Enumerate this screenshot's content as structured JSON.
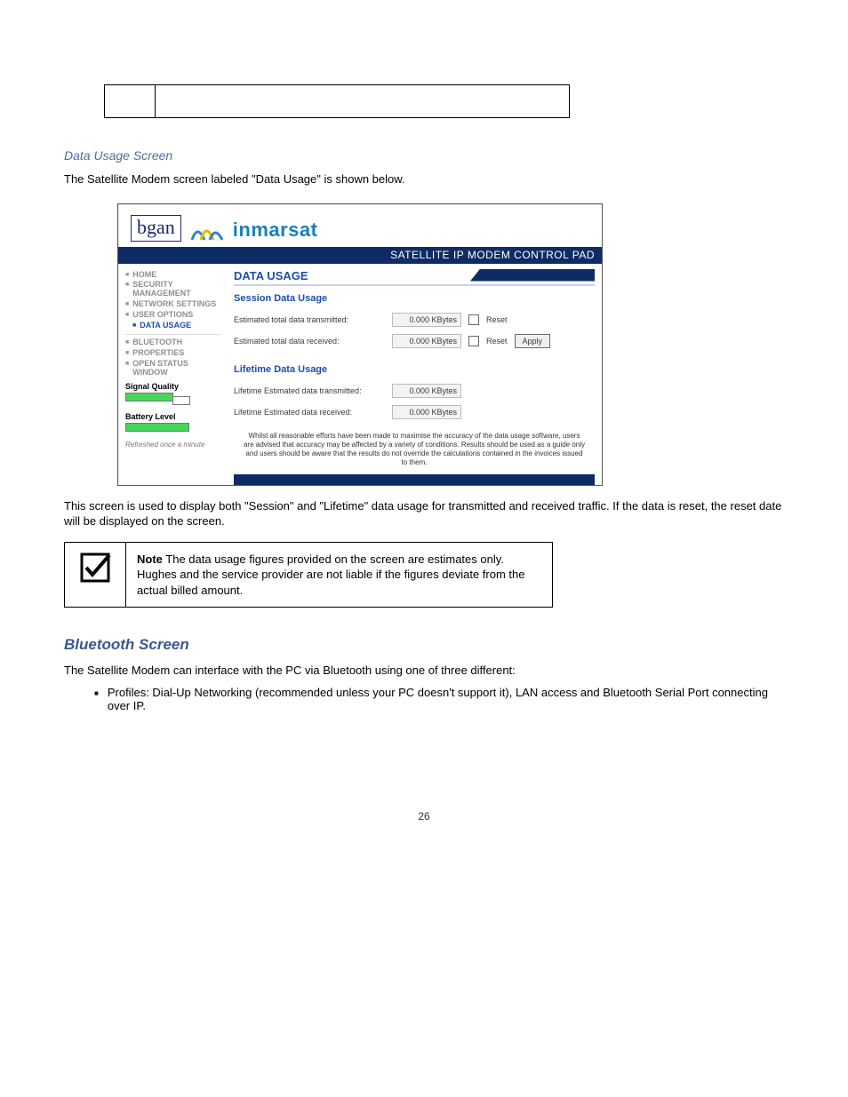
{
  "top_table": {
    "c1": "",
    "c2": ""
  },
  "section": {
    "heading": "Data Usage Screen",
    "intro": "The Satellite Modem screen labeled \"Data Usage\" is shown below."
  },
  "shot": {
    "logo": {
      "bgan": "bgan",
      "inmarsat": "inmarsat"
    },
    "bar": "SATELLITE IP MODEM CONTROL PAD",
    "side": {
      "home": "HOME",
      "sec": "SECURITY MANAGEMENT",
      "net": "NETWORK SETTINGS",
      "user": "USER OPTIONS",
      "data": "DATA USAGE",
      "bt": "BLUETOOTH",
      "prop": "PROPERTIES",
      "osw": "OPEN STATUS WINDOW",
      "sig": "Signal Quality",
      "bat": "Battery Level",
      "note": "Refreshed once a minute"
    },
    "main": {
      "title": "DATA USAGE",
      "session_h": "Session Data Usage",
      "s_tx_l": "Estimated total data transmitted:",
      "s_rx_l": "Estimated total data received:",
      "life_h": "Lifetime Data Usage",
      "l_tx_l": "Lifetime Estimated data transmitted:",
      "l_rx_l": "Lifetime Estimated data received:",
      "val": "0.000 KBytes",
      "reset": "Reset",
      "apply": "Apply",
      "disclaimer": "Whilst all reasonable efforts have been made to maximise the accuracy of the data usage software, users are advised that accuracy may be affected by a variety of conditions. Results should be used as a guide only and users should be aware that the results do not override the calculations contained in the invoices issued to them."
    }
  },
  "after_shot": "This screen is used to display both \"Session\" and \"Lifetime\" data usage for transmitted and received traffic. If the data is reset, the reset date will be displayed on the screen.",
  "note": {
    "label": "Note",
    "text": "The data usage figures provided on the screen are estimates only. Hughes and the service provider are not liable if the figures deviate from the actual billed amount."
  },
  "bluetooth": {
    "heading": "Bluetooth Screen",
    "intro": "The Satellite Modem can interface with the PC via Bluetooth using one of three different:",
    "bullet": "Profiles: Dial-Up Networking (recommended unless your PC doesn't support it), LAN access and Bluetooth Serial Port connecting over IP."
  },
  "footer": "26"
}
